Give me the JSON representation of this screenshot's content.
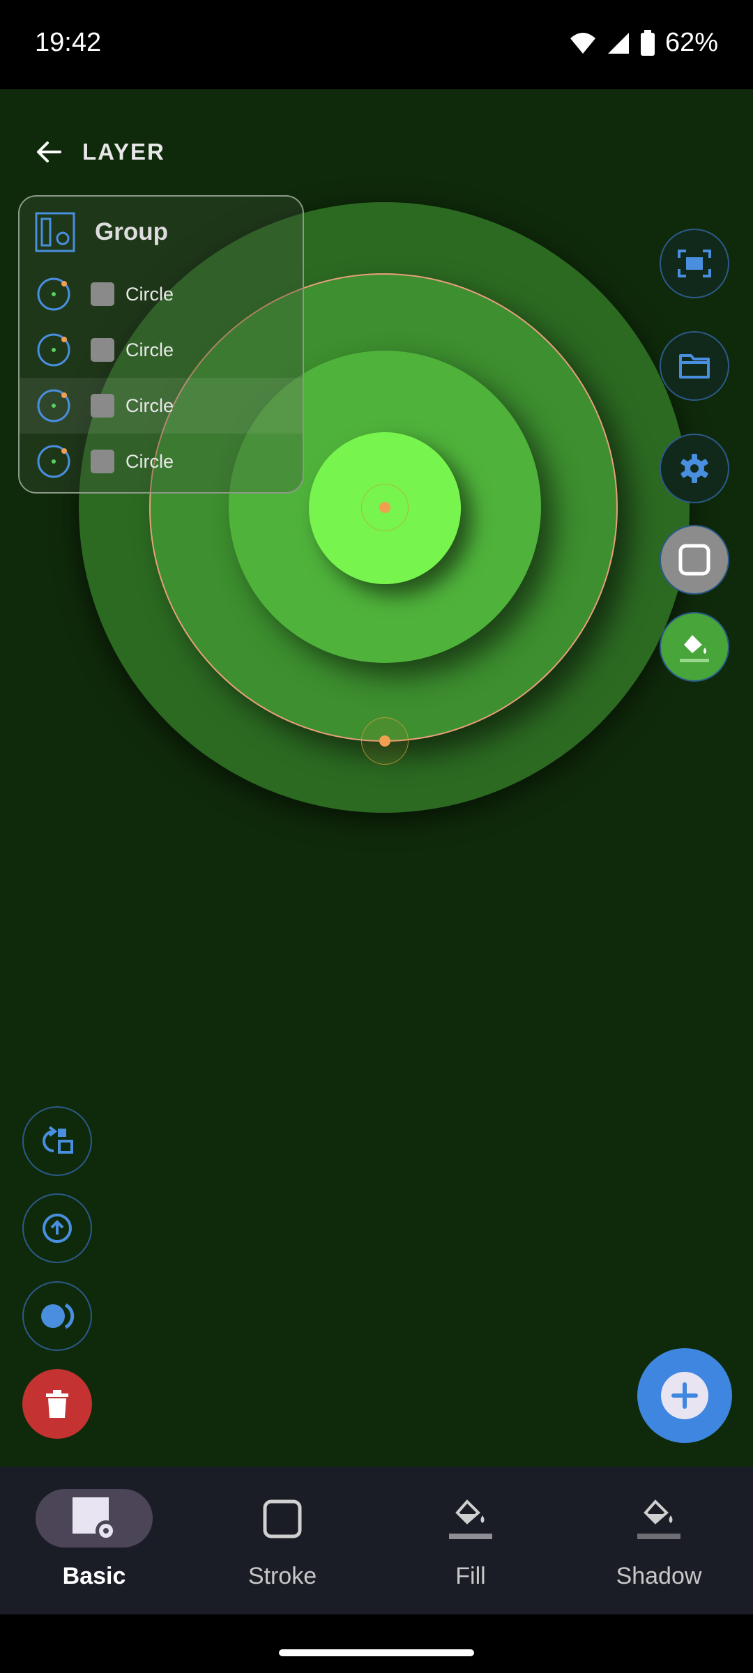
{
  "status": {
    "time": "19:42",
    "battery": "62%"
  },
  "toolbar": {
    "back_icon": "arrow-left-icon",
    "title": "LAYER"
  },
  "layers": {
    "group_label": "Group",
    "items": [
      {
        "label": "Circle"
      },
      {
        "label": "Circle"
      },
      {
        "label": "Circle"
      },
      {
        "label": "Circle"
      }
    ]
  },
  "right_tools": [
    "fit-screen-icon",
    "folder-icon",
    "settings-icon",
    "stroke-square-icon",
    "fill-bucket-icon"
  ],
  "left_tools": [
    "replace-shape-icon",
    "move-up-icon",
    "toggle-shape-icon",
    "delete-icon"
  ],
  "nav": {
    "basic": "Basic",
    "stroke": "Stroke",
    "fill": "Fill",
    "shadow": "Shadow"
  },
  "colors": {
    "background": "#0f2a0a",
    "accent": "#4a8ee0",
    "outer_circle": "#2c6a22",
    "ring2": "#3d8f2f",
    "ring3": "#4fb33b",
    "inner_circle": "#78f44e",
    "selection": "#f0a050",
    "delete": "#c43232"
  }
}
